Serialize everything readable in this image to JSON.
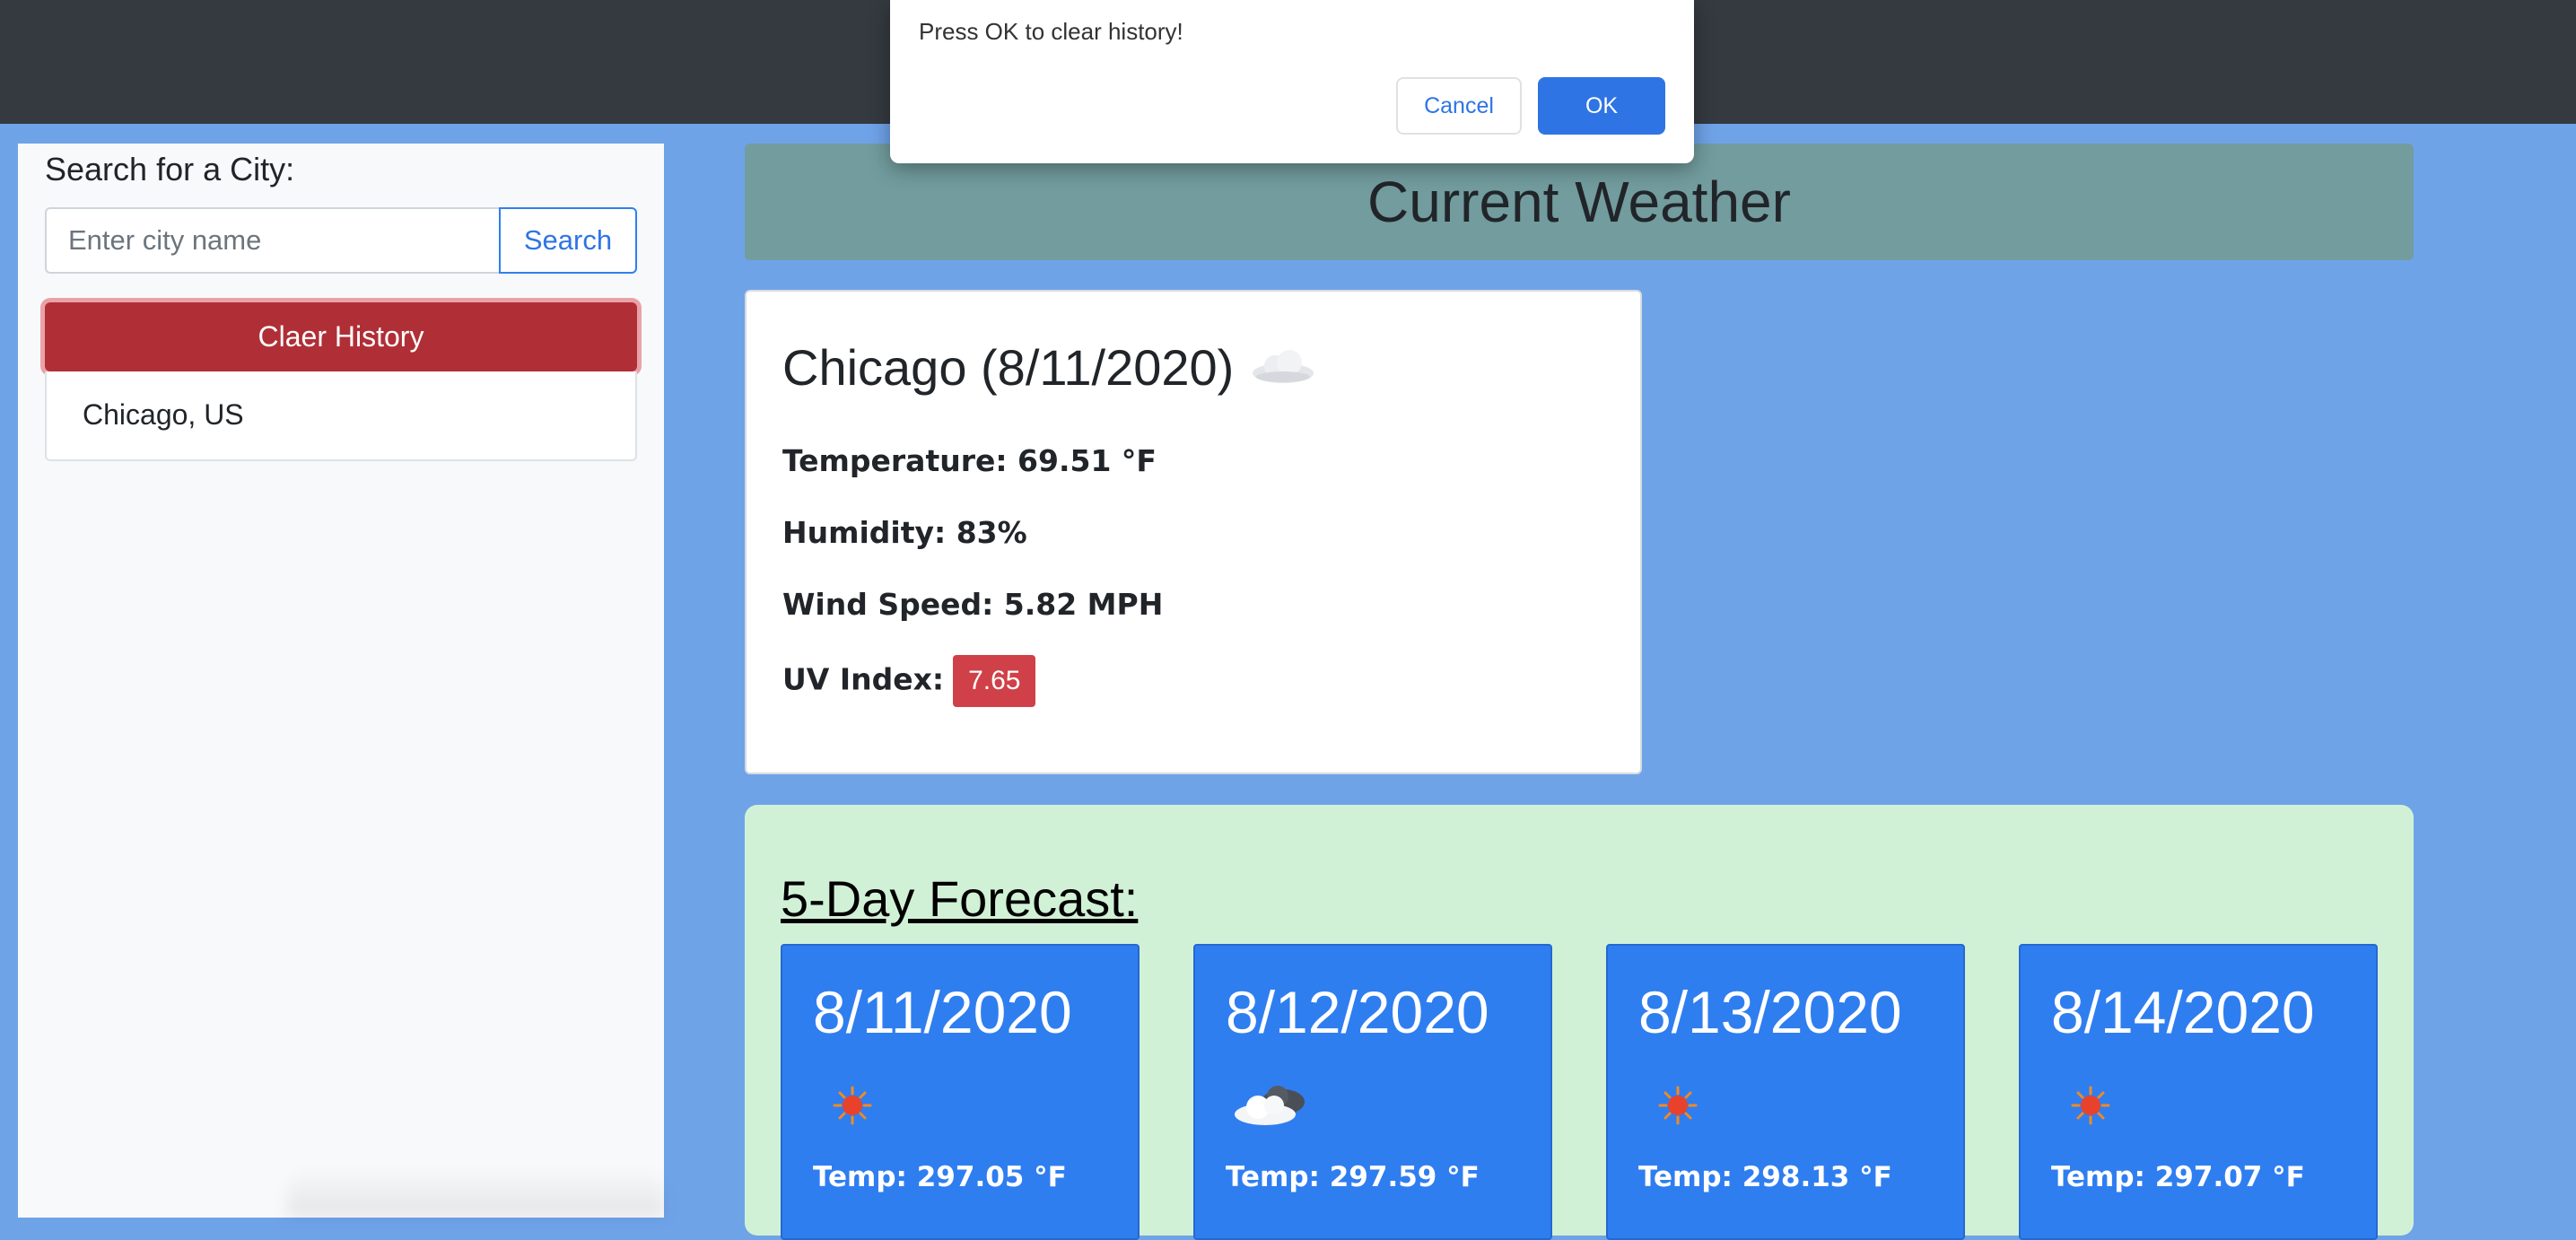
{
  "sidebar": {
    "search_title": "Search for a City:",
    "search_placeholder": "Enter city name",
    "search_button": "Search",
    "clear_button": "Claer History",
    "history": [
      {
        "label": "Chicago, US"
      }
    ]
  },
  "current": {
    "header": "Current Weather",
    "city_title": "Chicago (8/11/2020)",
    "icon": "cloud-icon",
    "temperature": "Temperature: 69.51 °F",
    "humidity": "Humidity: 83%",
    "wind": "Wind Speed: 5.82 MPH",
    "uv_label": "UV Index:",
    "uv_value": "7.65"
  },
  "forecast": {
    "title": "5-Day Forecast:",
    "days": [
      {
        "date": "8/11/2020",
        "icon": "sun-icon",
        "temp": "Temp: 297.05 °F"
      },
      {
        "date": "8/12/2020",
        "icon": "cloudy-icon",
        "temp": "Temp: 297.59 °F"
      },
      {
        "date": "8/13/2020",
        "icon": "sun-icon",
        "temp": "Temp: 298.13 °F"
      },
      {
        "date": "8/14/2020",
        "icon": "sun-icon",
        "temp": "Temp: 297.07 °F"
      }
    ]
  },
  "dialog": {
    "message": "Press OK to clear history!",
    "cancel": "Cancel",
    "ok": "OK"
  },
  "colors": {
    "page_bg": "#6fa3e8",
    "topbar": "#343a40",
    "clear_button": "#b02f36",
    "current_header": "#729c9e",
    "uv_badge": "#d04048",
    "forecast_panel": "#d1f1d6",
    "forecast_card": "#2f7ef0",
    "primary": "#2f74e4"
  }
}
